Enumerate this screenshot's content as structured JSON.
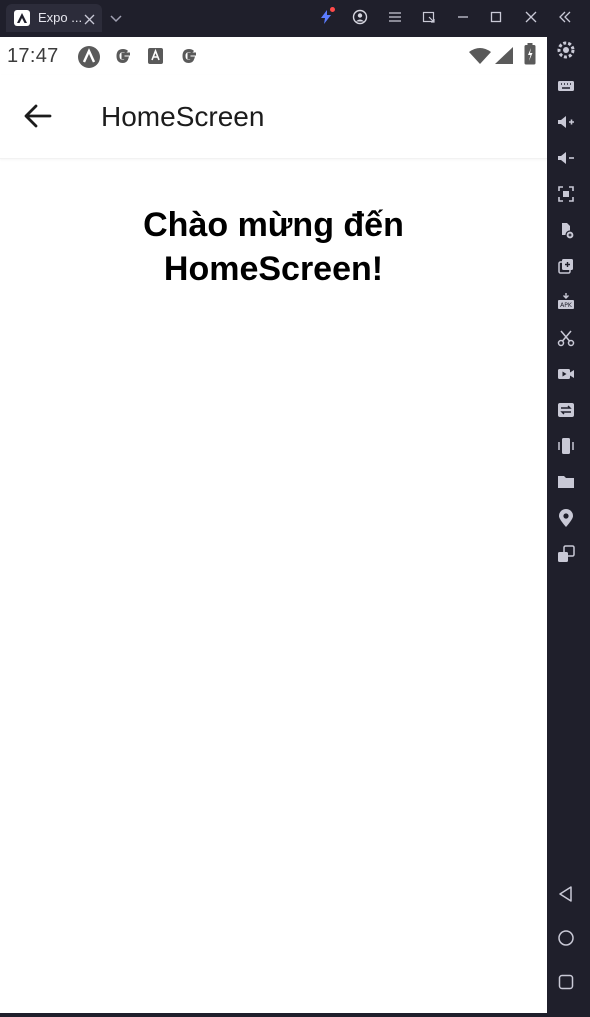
{
  "window": {
    "tab_title": "Expo ...",
    "icons": [
      "expo-icon",
      "close-icon",
      "chevron-down-icon",
      "bolt-icon",
      "account-icon",
      "menu-icon",
      "external-window-icon",
      "minimize-icon",
      "maximize-icon",
      "close-window-icon",
      "collapse-sidebar-icon"
    ],
    "notification_color": "#ff4a4a"
  },
  "status_bar": {
    "time": "17:47",
    "icons": [
      "app-icon-a",
      "google-icon",
      "translate-icon",
      "google-icon",
      "wifi-icon",
      "signal-icon",
      "battery-icon"
    ]
  },
  "app_bar": {
    "title": "HomeScreen"
  },
  "content": {
    "welcome_line1": "Chào mừng đến",
    "welcome_line2": "HomeScreen!"
  },
  "emulator_sidebar": {
    "items": [
      "settings-icon",
      "keyboard-icon",
      "volume-up-icon",
      "volume-down-icon",
      "screenshot-icon",
      "rotate-icon",
      "multi-instance-icon",
      "apk-install-icon",
      "cut-icon",
      "record-icon",
      "sync-icon",
      "shake-icon",
      "folder-icon",
      "location-icon",
      "instance-manager-icon",
      "back-nav-icon",
      "home-nav-icon",
      "recents-nav-icon"
    ]
  },
  "colors": {
    "chrome_bg": "#1f1f2b",
    "screen_bg": "#ffffff",
    "text_dark": "#000000"
  }
}
